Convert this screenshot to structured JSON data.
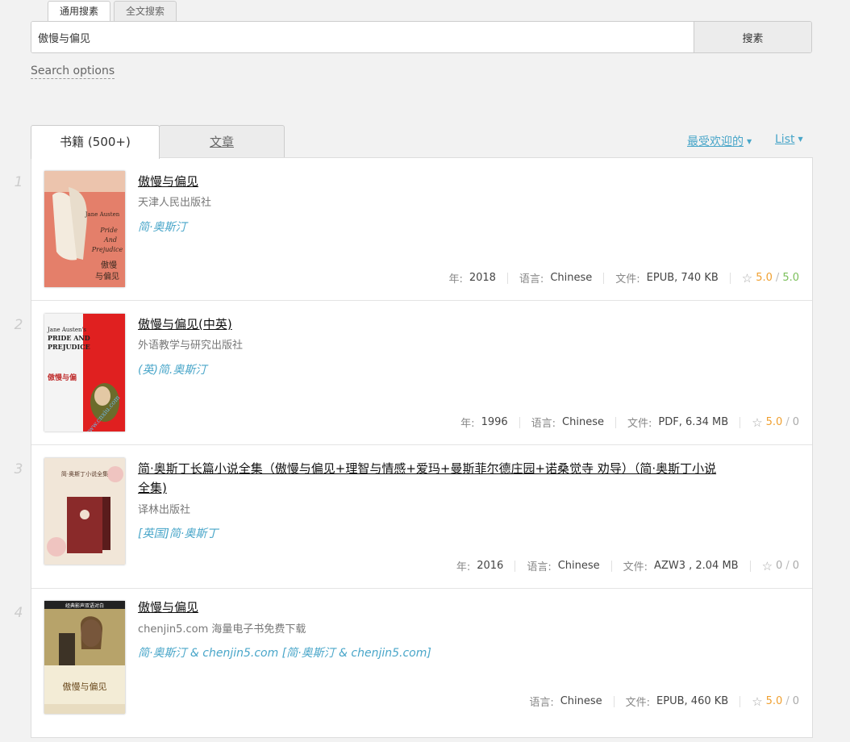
{
  "search": {
    "tabs": [
      "通用搜素",
      "全文搜索"
    ],
    "query": "傲慢与偏见",
    "button": "搜素",
    "options_link": "Search options"
  },
  "results_tabs": {
    "books": "书籍 (500+)",
    "articles": "文章"
  },
  "sort": {
    "label": "最受欢迎的",
    "view": "List"
  },
  "labels": {
    "year": "年:",
    "language": "语言:",
    "file": "文件:"
  },
  "books": [
    {
      "index": "1",
      "title": "傲慢与偏见",
      "publisher": "天津人民出版社",
      "author": "简·奥斯汀",
      "year": "2018",
      "language": "Chinese",
      "file": "EPUB, 740 KB",
      "rating_a": "5.0",
      "rating_b": "5.0",
      "cover_text": [
        "Jane Austen",
        "Pride",
        "And",
        "Prejudice",
        "傲慢",
        "与偏见"
      ]
    },
    {
      "index": "2",
      "title": "傲慢与偏见(中英)",
      "publisher": "外语教学与研究出版社",
      "author": "(英)简.奥斯汀",
      "year": "1996",
      "language": "Chinese",
      "file": "PDF, 6.34 MB",
      "rating_a": "5.0",
      "rating_b": "0",
      "cover_text": [
        "Jane Austen's",
        "PRIDE AND",
        "PREJUDICE",
        "傲慢与偏",
        "www.cnxiu.com"
      ]
    },
    {
      "index": "3",
      "title": "简·奥斯丁长篇小说全集（傲慢与偏见+理智与情感+爱玛+曼斯菲尔德庄园+诺桑觉寺 劝导）（简·奥斯丁小说全集)",
      "publisher": "译林出版社",
      "author": "[英国]简·奥斯丁",
      "year": "2016",
      "language": "Chinese",
      "file": "AZW3 , 2.04 MB",
      "rating_a": "0",
      "rating_b": "0",
      "cover_text": [
        "简·奥斯丁小说全集"
      ]
    },
    {
      "index": "4",
      "title": "傲慢与偏见",
      "publisher": "chenjin5.com 海量电子书免费下载",
      "author": "简·奥斯汀 & chenjin5.com [简·奥斯汀 & chenjin5.com]",
      "language": "Chinese",
      "file": "EPUB, 460 KB",
      "rating_a": "5.0",
      "rating_b": "0",
      "cover_text": [
        "经典影声双语对白",
        "傲慢与偏见"
      ]
    }
  ],
  "colors": {
    "link": "#49a6c9",
    "rating_orange": "#f0a030",
    "rating_green": "#7bbf5a",
    "background": "#f2f2f2"
  }
}
